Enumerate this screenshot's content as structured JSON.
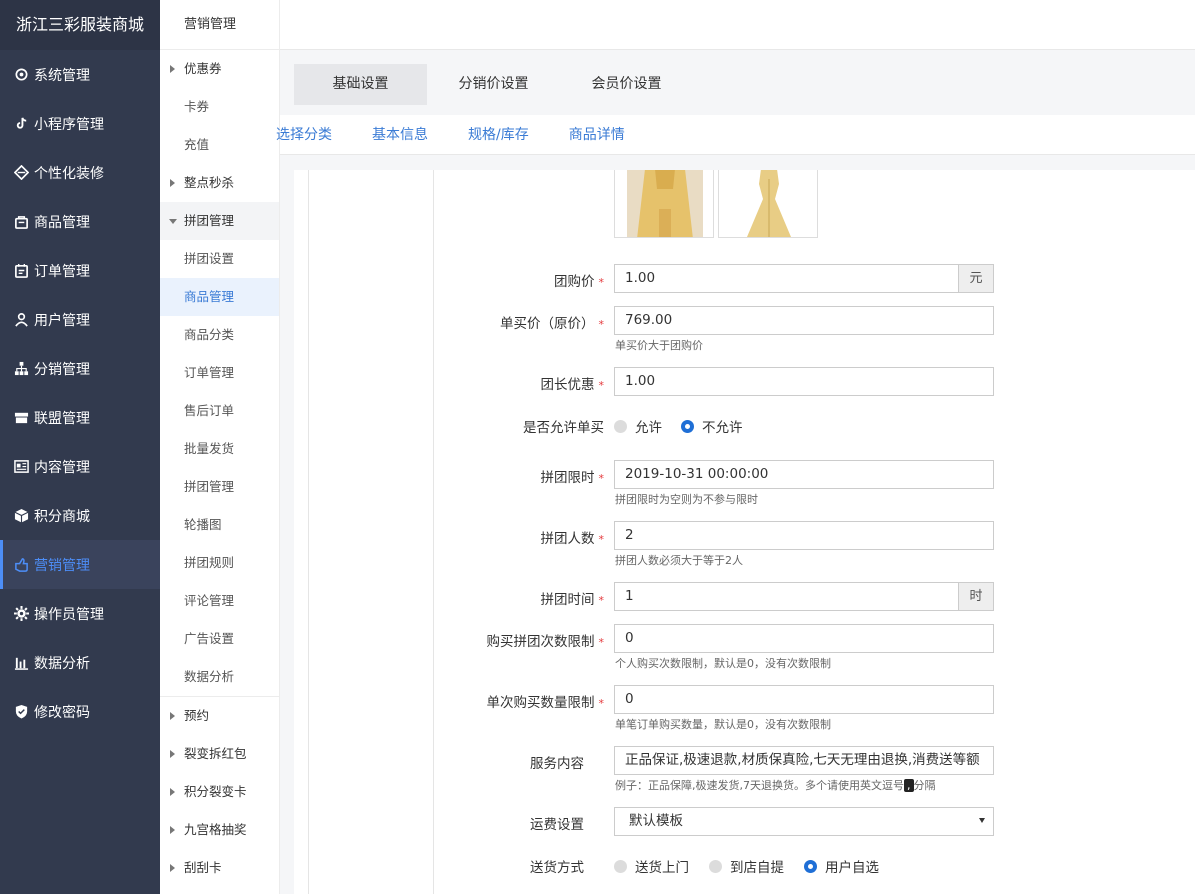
{
  "brand": "浙江三彩服装商城",
  "nav": [
    {
      "label": "系统管理",
      "icon": "gear-outline-icon"
    },
    {
      "label": "小程序管理",
      "icon": "tiktok-icon"
    },
    {
      "label": "个性化装修",
      "icon": "diamond-icon"
    },
    {
      "label": "商品管理",
      "icon": "bag-icon"
    },
    {
      "label": "订单管理",
      "icon": "clipboard-icon"
    },
    {
      "label": "用户管理",
      "icon": "user-icon"
    },
    {
      "label": "分销管理",
      "icon": "sitemap-icon"
    },
    {
      "label": "联盟管理",
      "icon": "store-icon"
    },
    {
      "label": "内容管理",
      "icon": "news-icon"
    },
    {
      "label": "积分商城",
      "icon": "cube-icon"
    },
    {
      "label": "营销管理",
      "icon": "hand-icon"
    },
    {
      "label": "操作员管理",
      "icon": "cog-icon"
    },
    {
      "label": "数据分析",
      "icon": "bar-chart-icon"
    },
    {
      "label": "修改密码",
      "icon": "shield-icon"
    }
  ],
  "submenu": {
    "title": "营销管理",
    "items": [
      "优惠券",
      "卡券",
      "充值",
      "整点秒杀",
      "拼团管理",
      "拼团设置",
      "商品管理",
      "商品分类",
      "订单管理",
      "售后订单",
      "批量发货",
      "拼团管理",
      "轮播图",
      "拼团规则",
      "评论管理",
      "广告设置",
      "数据分析"
    ],
    "groups": [
      "预约",
      "裂变拆红包",
      "积分裂变卡",
      "九宫格抽奖",
      "刮刮卡"
    ]
  },
  "tabs_top": [
    "基础设置",
    "分销价设置",
    "会员价设置"
  ],
  "tabs_sub": [
    "选择分类",
    "基本信息",
    "规格/库存",
    "商品详情"
  ],
  "form": {
    "group_price": {
      "label": "团购价",
      "value": "1.00",
      "addon": "元"
    },
    "single_price": {
      "label": "单买价（原价）",
      "value": "769.00",
      "help": "单买价大于团购价"
    },
    "leader_discount": {
      "label": "团长优惠",
      "value": "1.00"
    },
    "allow_single": {
      "label": "是否允许单买",
      "opt_yes": "允许",
      "opt_no": "不允许"
    },
    "time_limit": {
      "label": "拼团限时",
      "value": "2019-10-31 00:00:00",
      "help": "拼团限时为空则为不参与限时"
    },
    "group_size": {
      "label": "拼团人数",
      "value": "2",
      "help": "拼团人数必须大于等于2人"
    },
    "group_time": {
      "label": "拼团时间",
      "value": "1",
      "addon": "时"
    },
    "purchase_times": {
      "label": "购买拼团次数限制",
      "value": "0",
      "help": "个人购买次数限制，默认是0，没有次数限制"
    },
    "single_qty": {
      "label": "单次购买数量限制",
      "value": "0",
      "help": "单笔订单购买数量，默认是0，没有次数限制"
    },
    "service": {
      "label": "服务内容",
      "value": "正品保证,极速退款,材质保真险,七天无理由退换,消费送等额",
      "help_a": "例子：正品保障,极速发货,7天退换货。多个请使用英文逗号",
      "help_comma": ",",
      "help_b": "分隔"
    },
    "shipping": {
      "label": "运费设置",
      "value": "默认模板"
    },
    "delivery": {
      "label": "送货方式",
      "opt1": "送货上门",
      "opt2": "到店自提",
      "opt3": "用户自选"
    }
  }
}
